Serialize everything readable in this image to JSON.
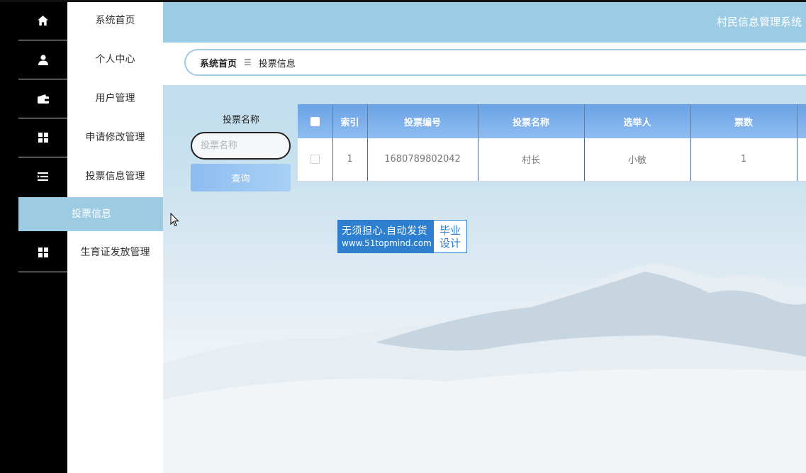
{
  "app": {
    "title": "村民信息管理系统"
  },
  "sidebar": {
    "items": [
      {
        "label": "系统首页",
        "icon": "home-icon"
      },
      {
        "label": "个人中心",
        "icon": "user-icon"
      },
      {
        "label": "用户管理",
        "icon": "wallet-icon"
      },
      {
        "label": "申请修改管理",
        "icon": "grid-icon"
      },
      {
        "label": "投票信息管理",
        "icon": "list-icon"
      },
      {
        "label": "生育证发放管理",
        "icon": "grid-icon"
      }
    ],
    "active_sub": "投票信息"
  },
  "breadcrumb": {
    "home": "系统首页",
    "separator": "☰",
    "current": "投票信息"
  },
  "search": {
    "label": "投票名称",
    "placeholder": "投票名称",
    "button": "查询"
  },
  "table": {
    "headers": [
      "索引",
      "投票编号",
      "投票名称",
      "选举人",
      "票数"
    ],
    "rows": [
      [
        "1",
        "1680789802042",
        "村长",
        "小敏",
        "1"
      ]
    ]
  },
  "watermark": {
    "line1": "无须担心.自动发货",
    "line2": "www.51topmind.com",
    "right1": "毕业",
    "right2": "设计"
  },
  "colors": {
    "header_blue": "#9ccbe4",
    "table_header": "#6aa2e6",
    "active_menu": "#9ccbe2",
    "watermark": "#2e7fd0"
  }
}
